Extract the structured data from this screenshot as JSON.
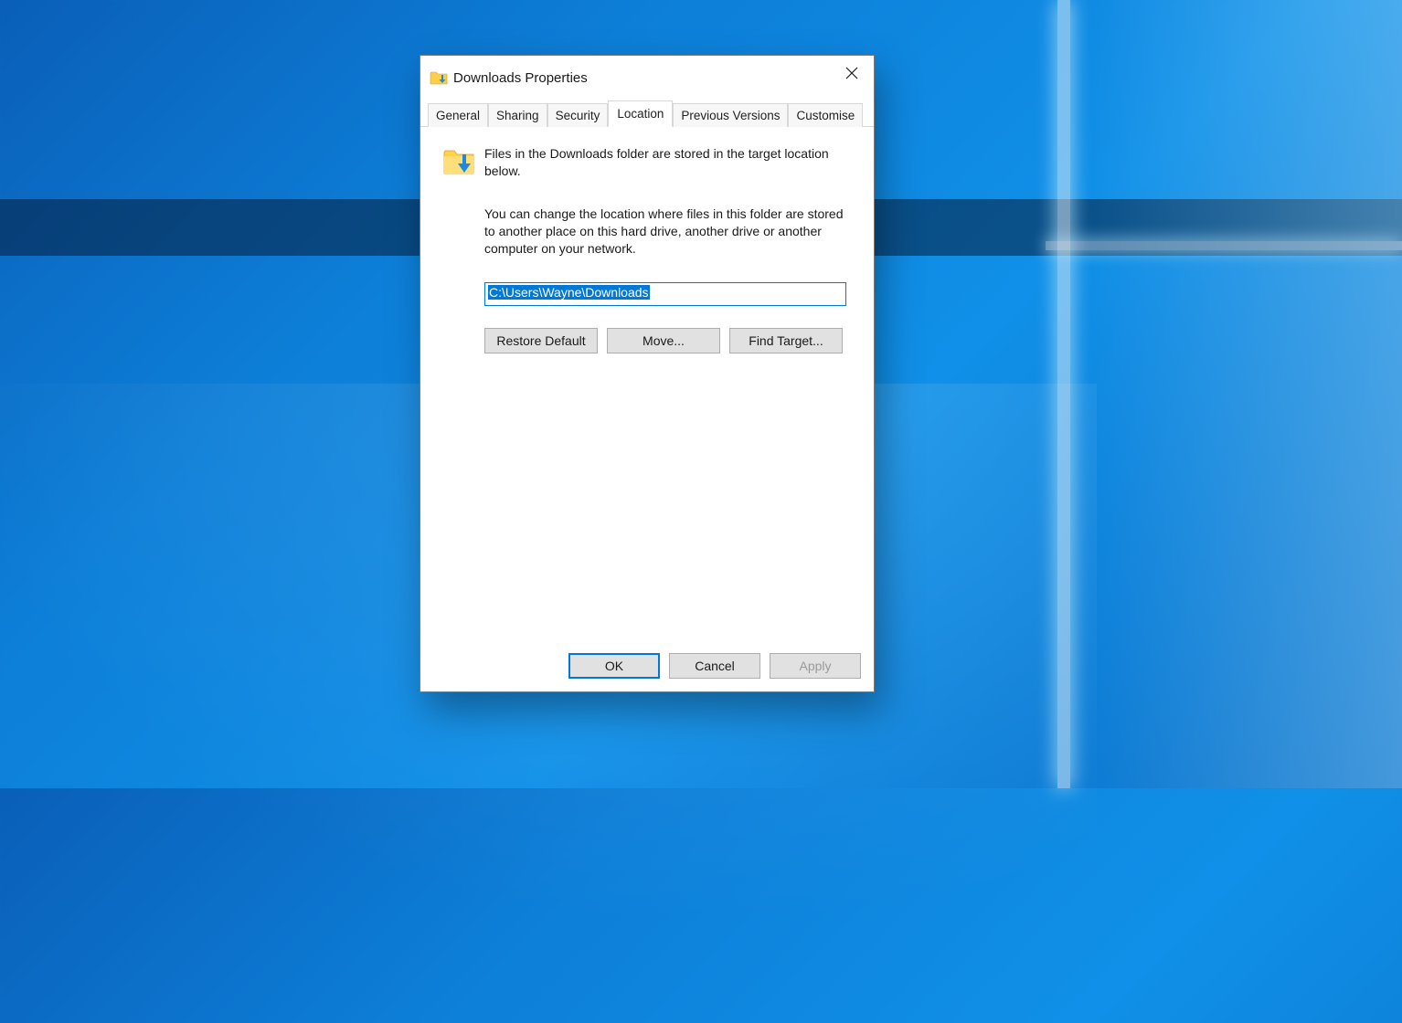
{
  "window": {
    "title": "Downloads Properties"
  },
  "tabs": {
    "general": "General",
    "sharing": "Sharing",
    "security": "Security",
    "location": "Location",
    "previous_versions": "Previous Versions",
    "customise": "Customise",
    "active": "location"
  },
  "content": {
    "intro": "Files in the Downloads folder are stored in the target location below.",
    "description": "You can change the location where files in this folder are stored to another place on this hard drive, another drive or another computer on your network.",
    "path_value": "C:\\Users\\Wayne\\Downloads",
    "buttons": {
      "restore_default": "Restore Default",
      "move": "Move...",
      "find_target": "Find Target..."
    }
  },
  "dialog_buttons": {
    "ok": "OK",
    "cancel": "Cancel",
    "apply": "Apply"
  }
}
